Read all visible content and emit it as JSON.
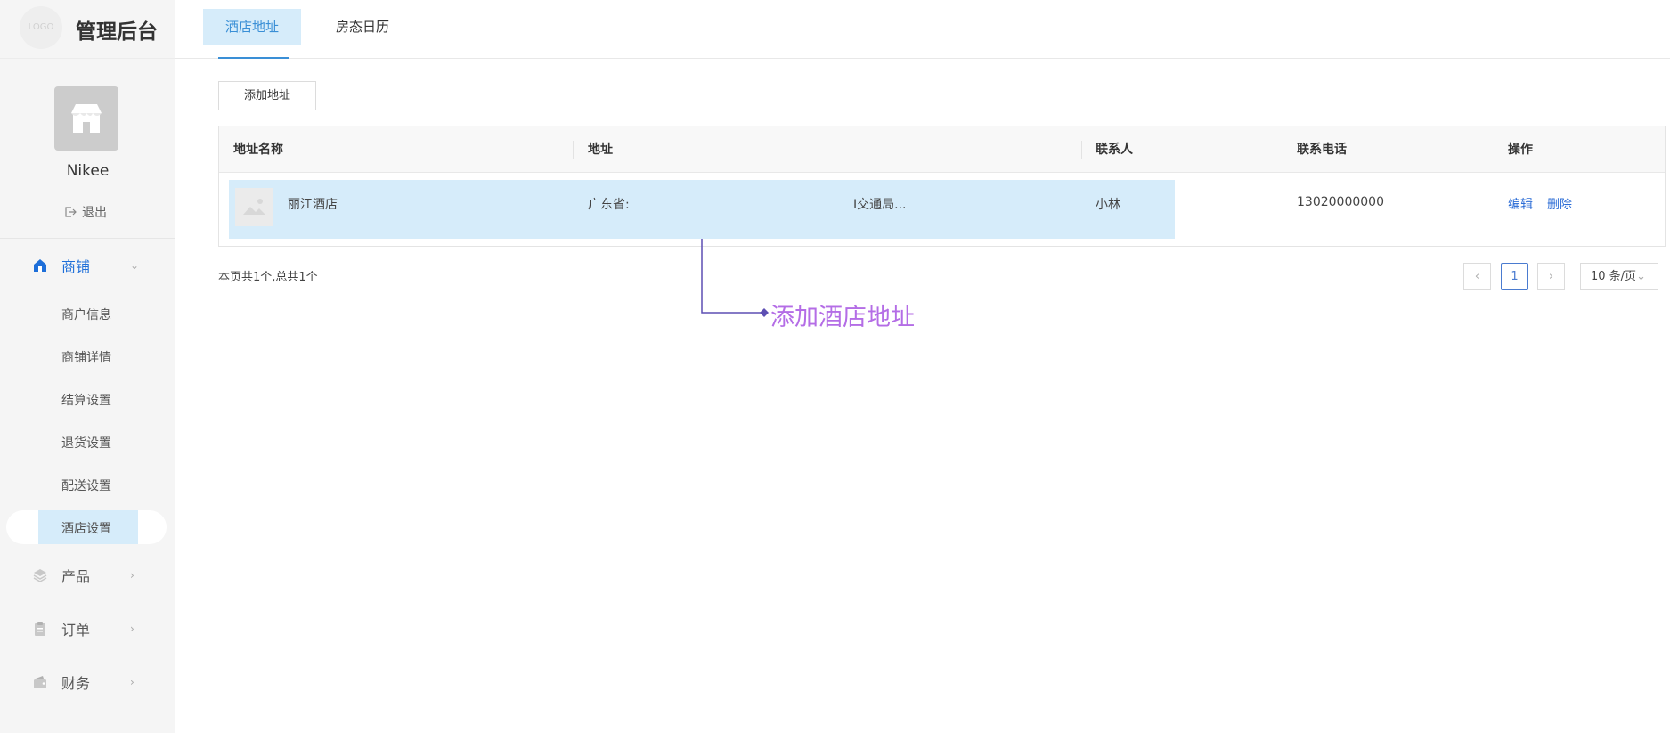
{
  "app": {
    "logo_text": "LOGO",
    "title": "管理后台"
  },
  "user": {
    "name": "Nikee",
    "logout_label": "退出"
  },
  "sidebar": {
    "groups": [
      {
        "label": "商铺",
        "icon": "home-icon",
        "expanded": true,
        "items": [
          {
            "label": "商户信息"
          },
          {
            "label": "商铺详情"
          },
          {
            "label": "结算设置"
          },
          {
            "label": "退货设置"
          },
          {
            "label": "配送设置"
          },
          {
            "label": "酒店设置",
            "active": true
          }
        ]
      },
      {
        "label": "产品",
        "icon": "layers-icon"
      },
      {
        "label": "订单",
        "icon": "clipboard-icon"
      },
      {
        "label": "财务",
        "icon": "wallet-icon"
      }
    ]
  },
  "tabs": [
    {
      "label": "酒店地址",
      "active": true
    },
    {
      "label": "房态日历"
    }
  ],
  "toolbar": {
    "add_label": "添加地址"
  },
  "table": {
    "columns": [
      "地址名称",
      "地址",
      "联系人",
      "联系电话",
      "操作"
    ],
    "rows": [
      {
        "name": "丽江酒店",
        "address_start": "广东省:",
        "address_end": "I交通局...",
        "contact": "小林",
        "phone": "13020000000",
        "edit": "编辑",
        "delete": "删除"
      }
    ]
  },
  "pagination": {
    "summary": "本页共1个,总共1个",
    "current_page": "1",
    "prev": "‹",
    "next": "›",
    "page_size": "10 条/页"
  },
  "annotation": {
    "text": "添加酒店地址",
    "color": "#b46de6"
  },
  "colors": {
    "accent": "#1e6fd9",
    "tab_active_bg": "#d6ecfa",
    "link": "#2b6cd6"
  }
}
